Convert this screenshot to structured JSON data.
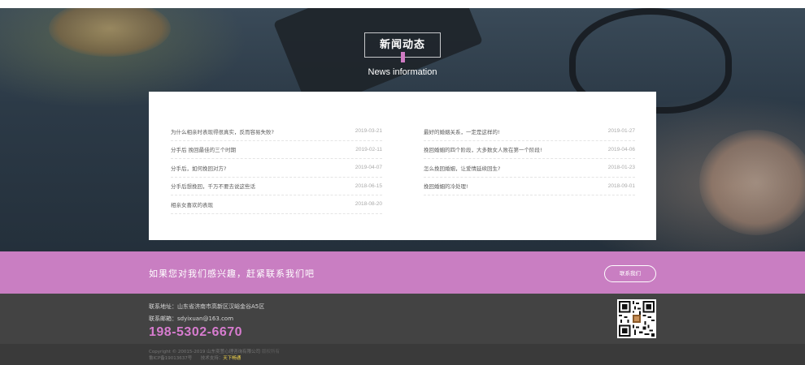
{
  "news": {
    "title": "新闻动态",
    "subtitle": "News information",
    "left": [
      {
        "title": "为什么相亲时表现得很真实，反而容易失败?",
        "date": "2019-03-21"
      },
      {
        "title": "分手后 挽回最佳的三个时期",
        "date": "2019-02-11"
      },
      {
        "title": "分手后，如何挽回对方?",
        "date": "2019-04-07"
      },
      {
        "title": "分手后想挽回，千万不要去说这些话",
        "date": "2018-06-15"
      },
      {
        "title": "相亲女喜欢的表现",
        "date": "2018-08-20"
      }
    ],
    "right": [
      {
        "title": "最好的婚姻关系，一定是这样的!",
        "date": "2019-01-27"
      },
      {
        "title": "挽回婚姻的四个阶段，大多数女人败在第一个阶段!",
        "date": "2019-04-06"
      },
      {
        "title": "怎么挽回婚姻，让爱情延续回生?",
        "date": "2018-01-23"
      },
      {
        "title": "挽回婚姻的冷处理!",
        "date": "2018-09-01"
      }
    ]
  },
  "cta": {
    "text": "如果您对我们感兴趣，赶紧联系我们吧",
    "button": "联系我们",
    "accent": "#c97ec2"
  },
  "footer": {
    "address": "联系地址：山东省济南市高新区汉峪金谷A5区",
    "email": "联系邮箱：sdyixuan@163.com",
    "phone": "198-5302-6670",
    "copyright": "Copyright © 20015-2019  山东奕萱心理咨询有限公司",
    "rights": "版权所有",
    "icp": "鲁ICP备19013637号",
    "tech_label": "技术支持：",
    "tech_link": "天下畅通",
    "qr_icon": "qr-code-icon"
  }
}
